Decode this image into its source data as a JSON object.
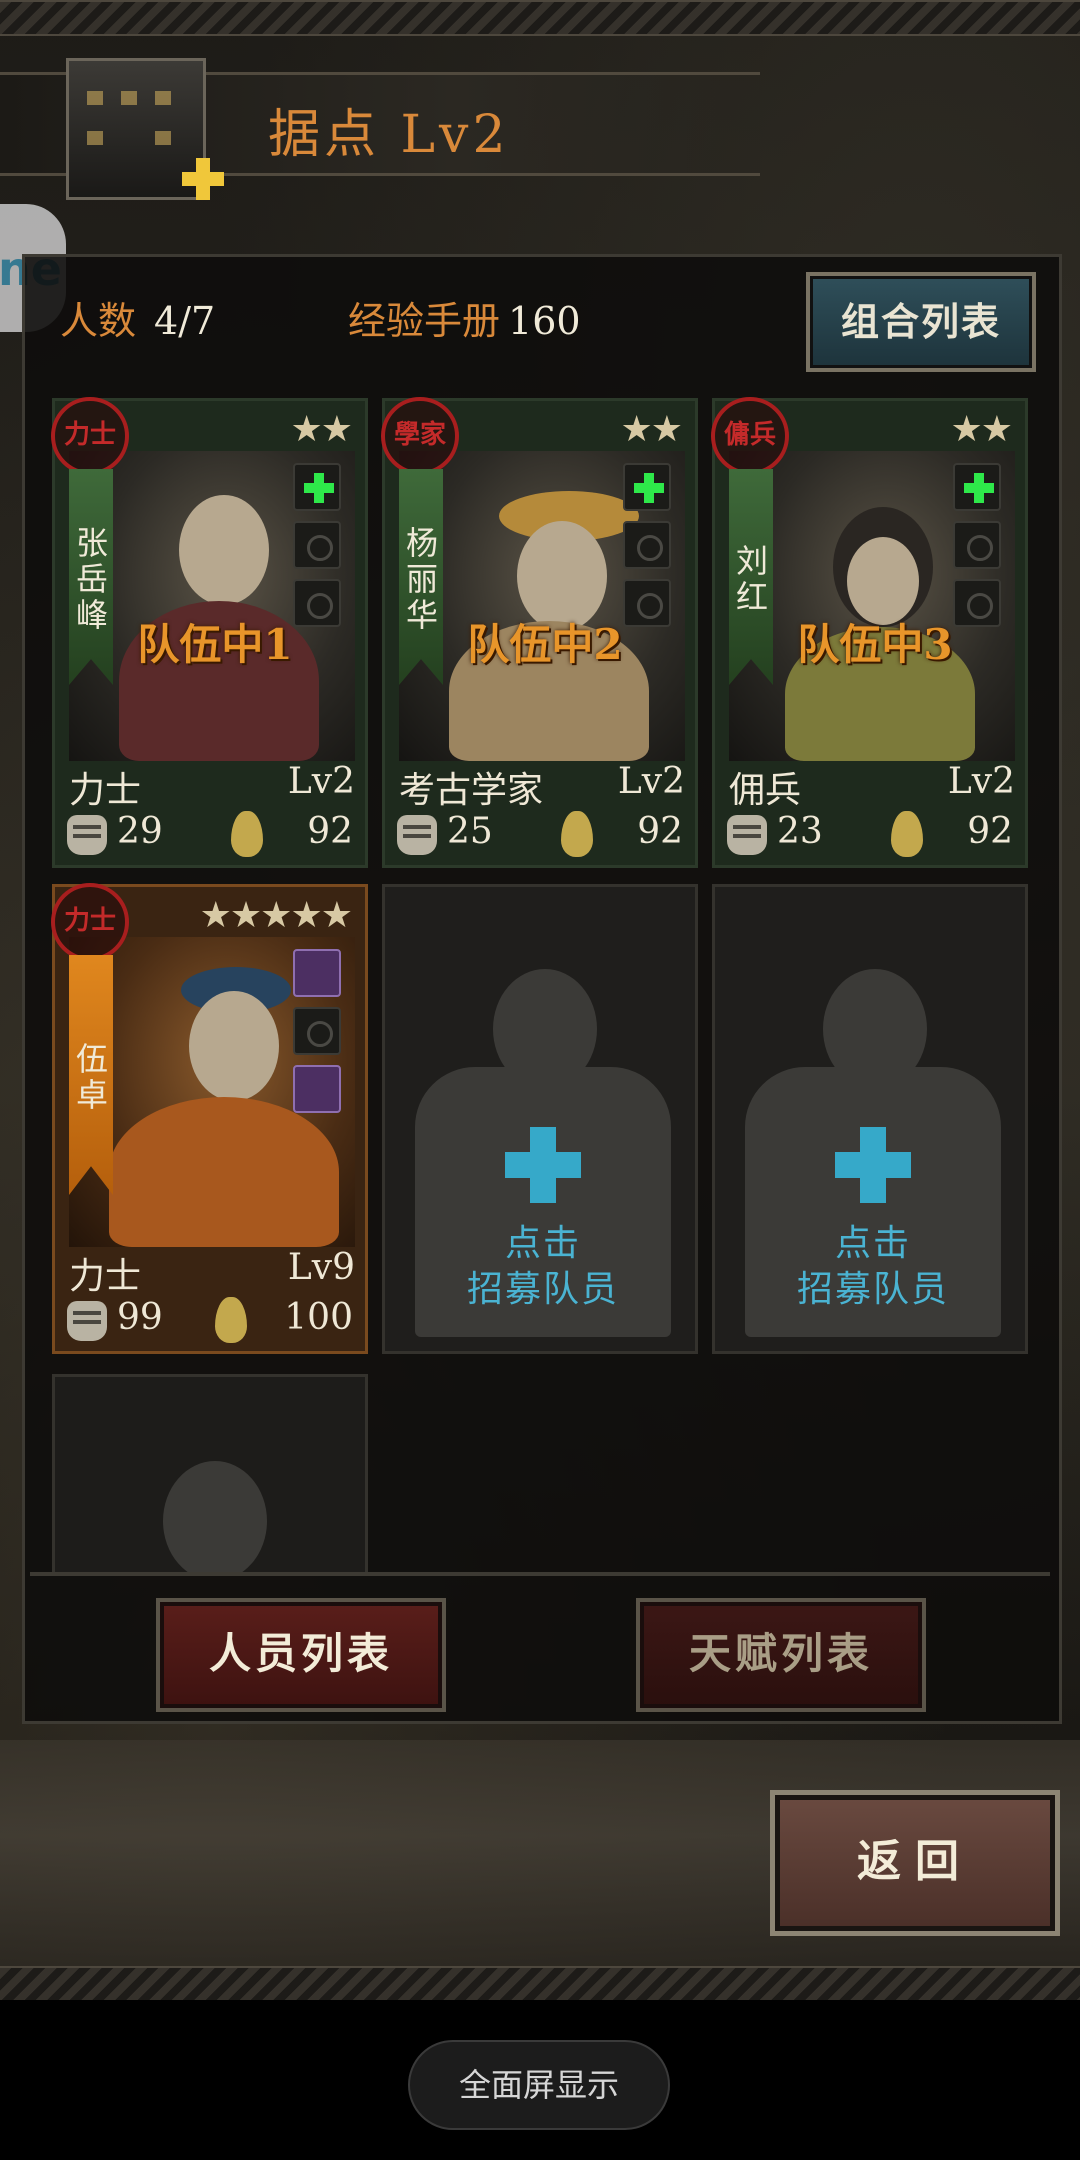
{
  "header": {
    "title": "据点 Lv2"
  },
  "side_tab": {
    "text": "ne"
  },
  "info": {
    "members_label": "人数",
    "members_value": "4/7",
    "exp_label": "经验手册",
    "exp_value": "160"
  },
  "combo_button": "组合列表",
  "cards": [
    {
      "seal": "力士",
      "name": "张岳峰",
      "stars": "★★",
      "team": "队伍中1",
      "class": "力士",
      "level": "Lv2",
      "stat_a": "29",
      "stat_b": "92"
    },
    {
      "seal": "學家",
      "name": "杨丽华",
      "stars": "★★",
      "team": "队伍中2",
      "class": "考古学家",
      "level": "Lv2",
      "stat_a": "25",
      "stat_b": "92"
    },
    {
      "seal": "傭兵",
      "name": "刘红",
      "stars": "★★",
      "team": "队伍中3",
      "class": "佣兵",
      "level": "Lv2",
      "stat_a": "23",
      "stat_b": "92"
    },
    {
      "seal": "力士",
      "name": "伍卓",
      "stars": "★★★★★",
      "team": "",
      "class": "力士",
      "level": "Lv9",
      "stat_a": "99",
      "stat_b": "100"
    }
  ],
  "recruit": {
    "line1": "点击",
    "line2": "招募队员"
  },
  "tabs": {
    "personnel": "人员列表",
    "talent": "天赋列表"
  },
  "back_button": "返回",
  "system": {
    "fullscreen": "全面屏显示"
  },
  "colors": {
    "accent_orange": "#d9893a",
    "teal": "#36a9c9",
    "green_plus": "#2ee84a"
  }
}
